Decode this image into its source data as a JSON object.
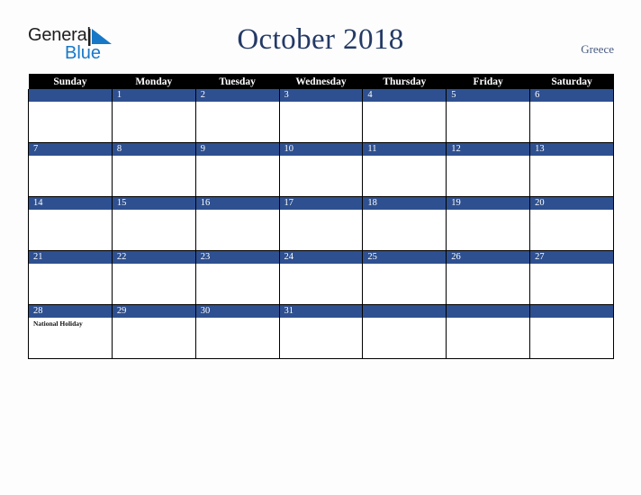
{
  "brand": {
    "name_top": "General",
    "name_bottom": "Blue",
    "triangle_icon": "blue-triangle-icon",
    "color_top": "#1d1d1d",
    "color_bottom": "#1878c8"
  },
  "header": {
    "title": "October 2018",
    "country": "Greece",
    "title_color": "#243a66",
    "country_color": "#4a5b83"
  },
  "calendar": {
    "accent_color": "#2e5090",
    "header_bg": "#000000",
    "header_text_color": "#ffffff",
    "weekdays": [
      "Sunday",
      "Monday",
      "Tuesday",
      "Wednesday",
      "Thursday",
      "Friday",
      "Saturday"
    ],
    "weeks": [
      [
        {
          "day": "",
          "events": []
        },
        {
          "day": "1",
          "events": []
        },
        {
          "day": "2",
          "events": []
        },
        {
          "day": "3",
          "events": []
        },
        {
          "day": "4",
          "events": []
        },
        {
          "day": "5",
          "events": []
        },
        {
          "day": "6",
          "events": []
        }
      ],
      [
        {
          "day": "7",
          "events": []
        },
        {
          "day": "8",
          "events": []
        },
        {
          "day": "9",
          "events": []
        },
        {
          "day": "10",
          "events": []
        },
        {
          "day": "11",
          "events": []
        },
        {
          "day": "12",
          "events": []
        },
        {
          "day": "13",
          "events": []
        }
      ],
      [
        {
          "day": "14",
          "events": []
        },
        {
          "day": "15",
          "events": []
        },
        {
          "day": "16",
          "events": []
        },
        {
          "day": "17",
          "events": []
        },
        {
          "day": "18",
          "events": []
        },
        {
          "day": "19",
          "events": []
        },
        {
          "day": "20",
          "events": []
        }
      ],
      [
        {
          "day": "21",
          "events": []
        },
        {
          "day": "22",
          "events": []
        },
        {
          "day": "23",
          "events": []
        },
        {
          "day": "24",
          "events": []
        },
        {
          "day": "25",
          "events": []
        },
        {
          "day": "26",
          "events": []
        },
        {
          "day": "27",
          "events": []
        }
      ],
      [
        {
          "day": "28",
          "events": [
            "National Holiday"
          ]
        },
        {
          "day": "29",
          "events": []
        },
        {
          "day": "30",
          "events": []
        },
        {
          "day": "31",
          "events": []
        },
        {
          "day": "",
          "events": []
        },
        {
          "day": "",
          "events": []
        },
        {
          "day": "",
          "events": []
        }
      ]
    ]
  }
}
